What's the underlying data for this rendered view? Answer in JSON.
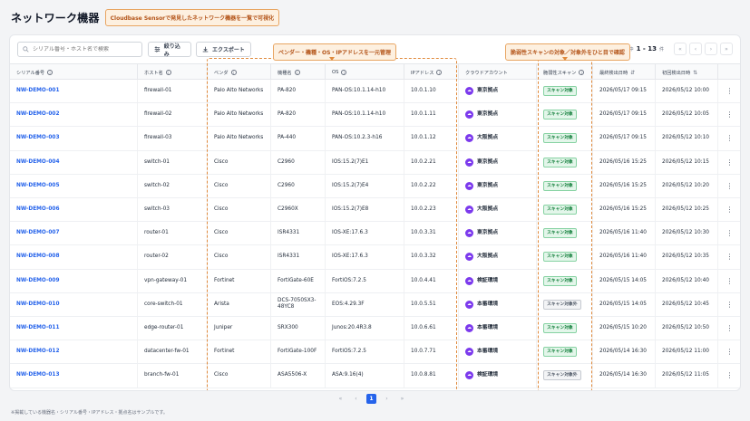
{
  "page": {
    "title": "ネットワーク機器",
    "title_callout": "Cloudbase Sensorで発見したネットワーク機器を一覧で可視化"
  },
  "toolbar": {
    "search_placeholder": "シリアル番号・ホスト名で検索",
    "filter_label": "絞り込み",
    "export_label": "エクスポート",
    "count_prefix": "件中",
    "count_range": "1 - 13",
    "count_suffix": "件"
  },
  "callouts": {
    "vendor_os": "ベンダー・機種・OS・IPアドレスを一元管理",
    "scan_target": "脆弱性スキャンの対象／対象外をひと目で確認"
  },
  "columns": {
    "serial": "シリアル番号",
    "host": "ホスト名",
    "vendor": "ベンダ",
    "model": "機種名",
    "os": "OS",
    "ip": "IPアドレス",
    "cloud": "クラウドアカウント",
    "scan": "脆弱性スキャン",
    "last": "最終検出日時",
    "first": "初回検出日時"
  },
  "rows": [
    {
      "serial": "NW-DEMO-001",
      "host": "firewall-01",
      "vendor": "Palo Alto Networks",
      "model": "PA-820",
      "os": "PAN-OS:10.1.14-h10",
      "ip": "10.0.1.10",
      "cloud": "東京拠点",
      "scan": "スキャン対象",
      "last": "2026/05/17 09:15",
      "first": "2026/05/12 10:00"
    },
    {
      "serial": "NW-DEMO-002",
      "host": "firewall-02",
      "vendor": "Palo Alto Networks",
      "model": "PA-820",
      "os": "PAN-OS:10.1.14-h10",
      "ip": "10.0.1.11",
      "cloud": "東京拠点",
      "scan": "スキャン対象",
      "last": "2026/05/17 09:15",
      "first": "2026/05/12 10:05"
    },
    {
      "serial": "NW-DEMO-003",
      "host": "firewall-03",
      "vendor": "Palo Alto Networks",
      "model": "PA-440",
      "os": "PAN-OS:10.2.3-h16",
      "ip": "10.0.1.12",
      "cloud": "大阪拠点",
      "scan": "スキャン対象",
      "last": "2026/05/17 09:15",
      "first": "2026/05/12 10:10"
    },
    {
      "serial": "NW-DEMO-004",
      "host": "switch-01",
      "vendor": "Cisco",
      "model": "C2960",
      "os": "IOS:15.2(7)E1",
      "ip": "10.0.2.21",
      "cloud": "東京拠点",
      "scan": "スキャン対象",
      "last": "2026/05/16 15:25",
      "first": "2026/05/12 10:15"
    },
    {
      "serial": "NW-DEMO-005",
      "host": "switch-02",
      "vendor": "Cisco",
      "model": "C2960",
      "os": "IOS:15.2(7)E4",
      "ip": "10.0.2.22",
      "cloud": "東京拠点",
      "scan": "スキャン対象",
      "last": "2026/05/16 15:25",
      "first": "2026/05/12 10:20"
    },
    {
      "serial": "NW-DEMO-006",
      "host": "switch-03",
      "vendor": "Cisco",
      "model": "C2960X",
      "os": "IOS:15.2(7)E8",
      "ip": "10.0.2.23",
      "cloud": "大阪拠点",
      "scan": "スキャン対象",
      "last": "2026/05/16 15:25",
      "first": "2026/05/12 10:25"
    },
    {
      "serial": "NW-DEMO-007",
      "host": "router-01",
      "vendor": "Cisco",
      "model": "ISR4331",
      "os": "IOS-XE:17.6.3",
      "ip": "10.0.3.31",
      "cloud": "東京拠点",
      "scan": "スキャン対象",
      "last": "2026/05/16 11:40",
      "first": "2026/05/12 10:30"
    },
    {
      "serial": "NW-DEMO-008",
      "host": "router-02",
      "vendor": "Cisco",
      "model": "ISR4331",
      "os": "IOS-XE:17.6.3",
      "ip": "10.0.3.32",
      "cloud": "大阪拠点",
      "scan": "スキャン対象",
      "last": "2026/05/16 11:40",
      "first": "2026/05/12 10:35"
    },
    {
      "serial": "NW-DEMO-009",
      "host": "vpn-gateway-01",
      "vendor": "Fortinet",
      "model": "FortiGate-60E",
      "os": "FortiOS:7.2.5",
      "ip": "10.0.4.41",
      "cloud": "検証環境",
      "scan": "スキャン対象",
      "last": "2026/05/15 14:05",
      "first": "2026/05/12 10:40"
    },
    {
      "serial": "NW-DEMO-010",
      "host": "core-switch-01",
      "vendor": "Arista",
      "model": "DCS-7050SX3-48YC8",
      "os": "EOS:4.29.3F",
      "ip": "10.0.5.51",
      "cloud": "本番環境",
      "scan": "スキャン対象外",
      "last": "2026/05/15 14:05",
      "first": "2026/05/12 10:45"
    },
    {
      "serial": "NW-DEMO-011",
      "host": "edge-router-01",
      "vendor": "Juniper",
      "model": "SRX300",
      "os": "Junos:20.4R3.8",
      "ip": "10.0.6.61",
      "cloud": "本番環境",
      "scan": "スキャン対象",
      "last": "2026/05/15 10:20",
      "first": "2026/05/12 10:50"
    },
    {
      "serial": "NW-DEMO-012",
      "host": "datacenter-fw-01",
      "vendor": "Fortinet",
      "model": "FortiGate-100F",
      "os": "FortiOS:7.2.5",
      "ip": "10.0.7.71",
      "cloud": "本番環境",
      "scan": "スキャン対象",
      "last": "2026/05/14 16:30",
      "first": "2026/05/12 11:00"
    },
    {
      "serial": "NW-DEMO-013",
      "host": "branch-fw-01",
      "vendor": "Cisco",
      "model": "ASA5506-X",
      "os": "ASA:9.16(4)",
      "ip": "10.0.8.81",
      "cloud": "検証環境",
      "scan": "スキャン対象外",
      "last": "2026/05/14 16:30",
      "first": "2026/05/12 11:05"
    }
  ],
  "pagination": {
    "current": "1"
  },
  "footnote": "※掲載している機器名・シリアル番号・IPアドレス・拠点名はサンプルです。",
  "colors": {
    "accent": "#2563eb",
    "callout_border": "#e08a3c",
    "cloud_icon": "#7c3aed",
    "badge_green": "#15803d"
  }
}
